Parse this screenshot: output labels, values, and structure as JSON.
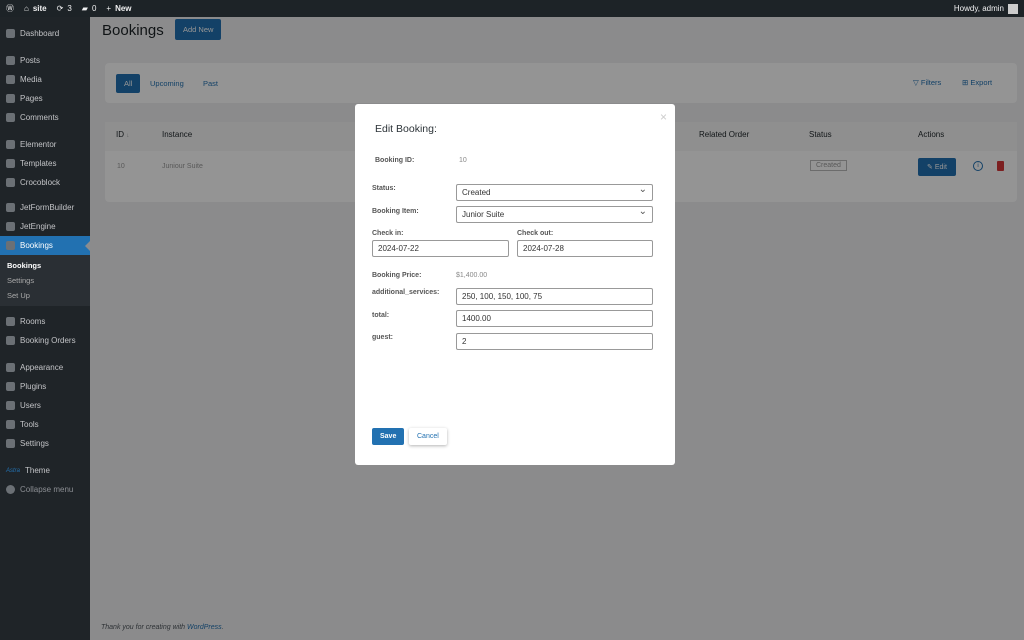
{
  "adminbar": {
    "site": "site",
    "updates": "3",
    "comments": "0",
    "new": "New",
    "howdy": "Howdy, admin"
  },
  "sidebar": {
    "items": [
      "Dashboard",
      "Posts",
      "Media",
      "Pages",
      "Comments",
      "Elementor",
      "Templates",
      "Crocoblock",
      "JetFormBuilder",
      "JetEngine",
      "Bookings",
      "Rooms",
      "Booking Orders",
      "Appearance",
      "Plugins",
      "Users",
      "Tools",
      "Settings",
      "Theme",
      "Collapse menu"
    ],
    "sub": [
      "Bookings",
      "Settings",
      "Set Up"
    ],
    "theme_logo": "Astra"
  },
  "page": {
    "title": "Bookings",
    "add_new": "Add New",
    "filters": {
      "all": "All",
      "upcoming": "Upcoming",
      "past": "Past",
      "filters": "Filters",
      "export": "Export"
    },
    "table": {
      "headers": [
        "ID",
        "Instance",
        "Related Order",
        "Status",
        "Actions"
      ],
      "row": {
        "id": "10",
        "instance": "Juniour Suite",
        "status": "Created",
        "edit": "Edit"
      }
    },
    "footer": {
      "text": "Thank you for creating with ",
      "link": "WordPress",
      "dot": "."
    }
  },
  "modal": {
    "title": "Edit Booking:",
    "booking_id_label": "Booking ID:",
    "booking_id": "10",
    "status_label": "Status:",
    "status": "Created",
    "item_label": "Booking Item:",
    "item": "Junior Suite",
    "checkin_label": "Check in:",
    "checkin": "2024-07-22",
    "checkout_label": "Check out:",
    "checkout": "2024-07-28",
    "price_label": "Booking Price:",
    "price": "$1,400.00",
    "services_label": "additional_services:",
    "services": "250, 100, 150, 100, 75",
    "total_label": "total:",
    "total": "1400.00",
    "guest_label": "guest:",
    "guest": "2",
    "save": "Save",
    "cancel": "Cancel",
    "close": "×"
  }
}
